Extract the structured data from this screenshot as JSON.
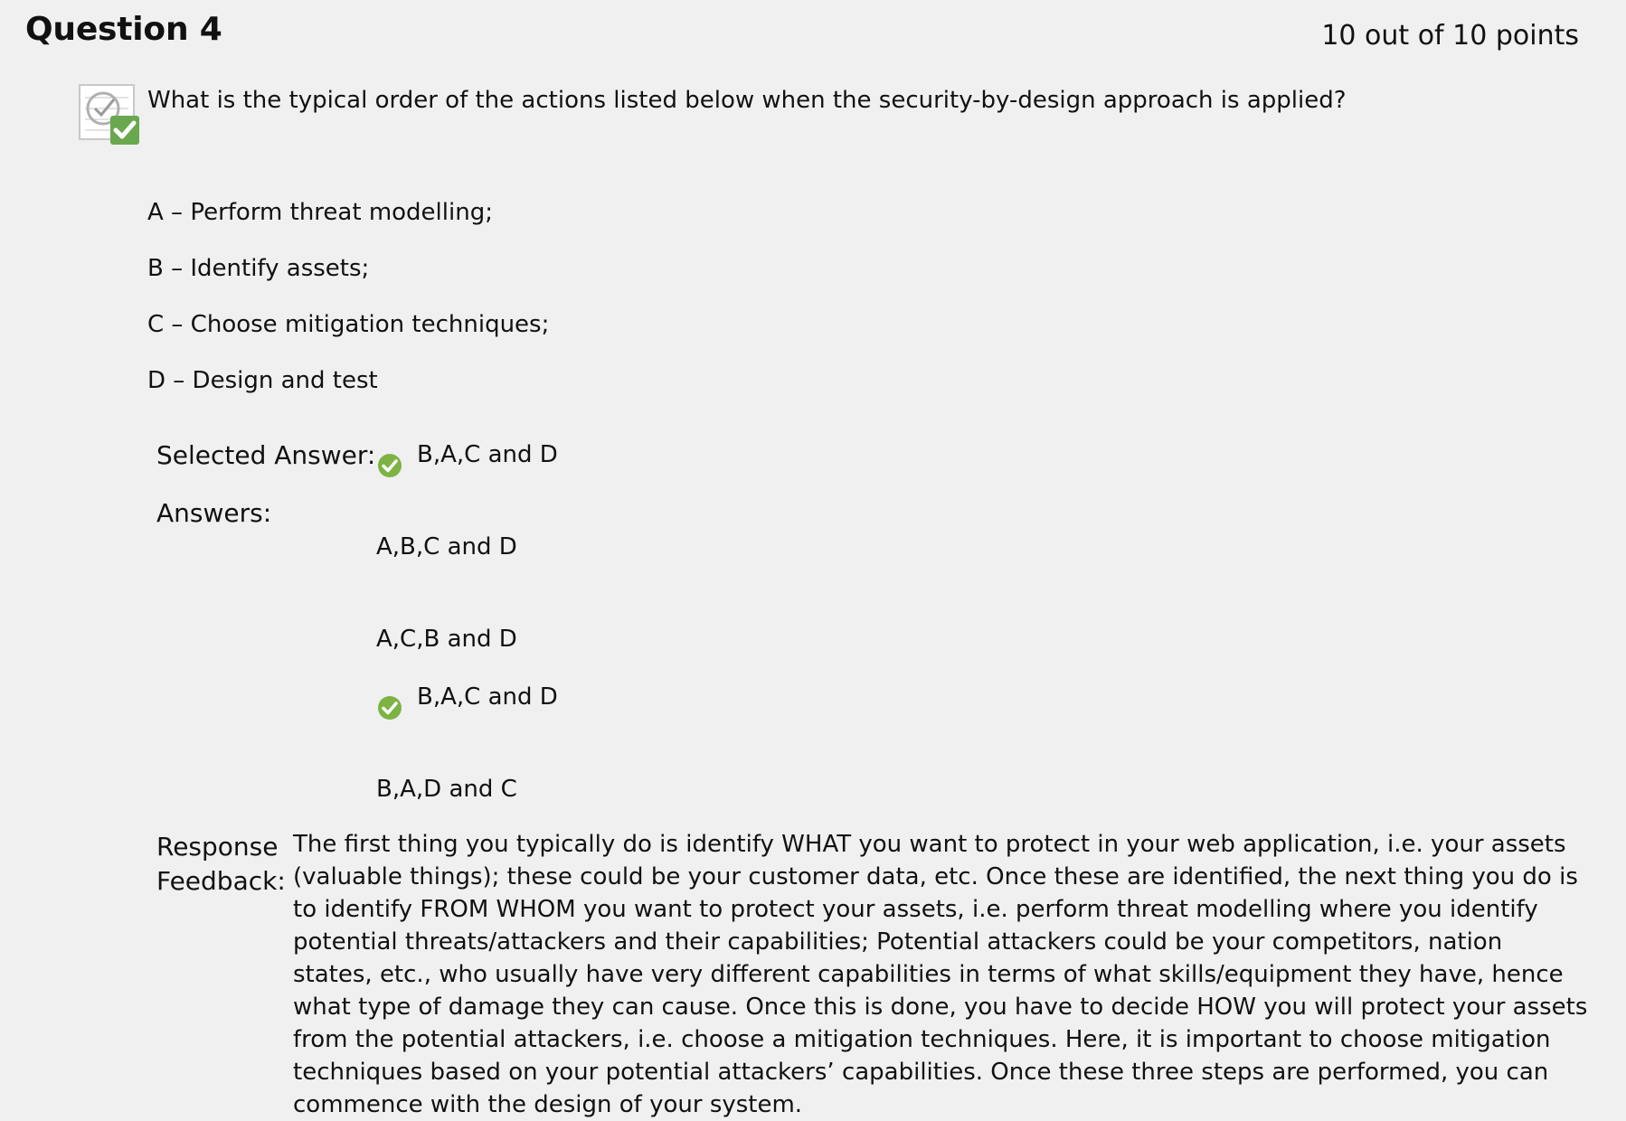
{
  "question": {
    "title": "Question 4",
    "points": "10 out of 10 points",
    "icon": "graded-correct-icon",
    "text": "What is the typical order of the actions listed below when the security-by-design approach is applied?",
    "options": [
      "A – Perform threat modelling;",
      "B – Identify assets;",
      "C – Choose mitigation techniques;",
      "D – Design and test"
    ]
  },
  "selected": {
    "label": "Selected Answer:",
    "value": "B,A,C and D",
    "icon": "correct-check-icon"
  },
  "answers": {
    "label": "Answers:",
    "items": [
      {
        "text": "A,B,C and D",
        "correct": false
      },
      {
        "text": "A,C,B and D",
        "correct": false
      },
      {
        "text": "B,A,C and D",
        "correct": true
      },
      {
        "text": "B,A,D and C",
        "correct": false
      }
    ]
  },
  "feedback": {
    "label_line1": "Response",
    "label_line2": "Feedback:",
    "text": "The first thing you typically do is identify WHAT you want to protect in your web application, i.e. your assets (valuable things); these could be your customer data, etc. Once these are identified, the next thing you do is to identify FROM WHOM you want to protect your assets, i.e. perform threat modelling where you identify potential threats/attackers and their capabilities; Potential attackers could be your competitors, nation states, etc., who usually have very different capabilities in terms of what skills/equipment they have, hence what type of damage they can cause. Once this is done, you have to decide HOW you will protect your assets from the potential attackers, i.e. choose a mitigation techniques. Here, it is important to choose mitigation techniques based on your potential attackers’ capabilities. Once these three steps are performed, you can commence with the design of your system."
  },
  "colors": {
    "check_green": "#7cb342",
    "background": "#f0f0f0"
  }
}
